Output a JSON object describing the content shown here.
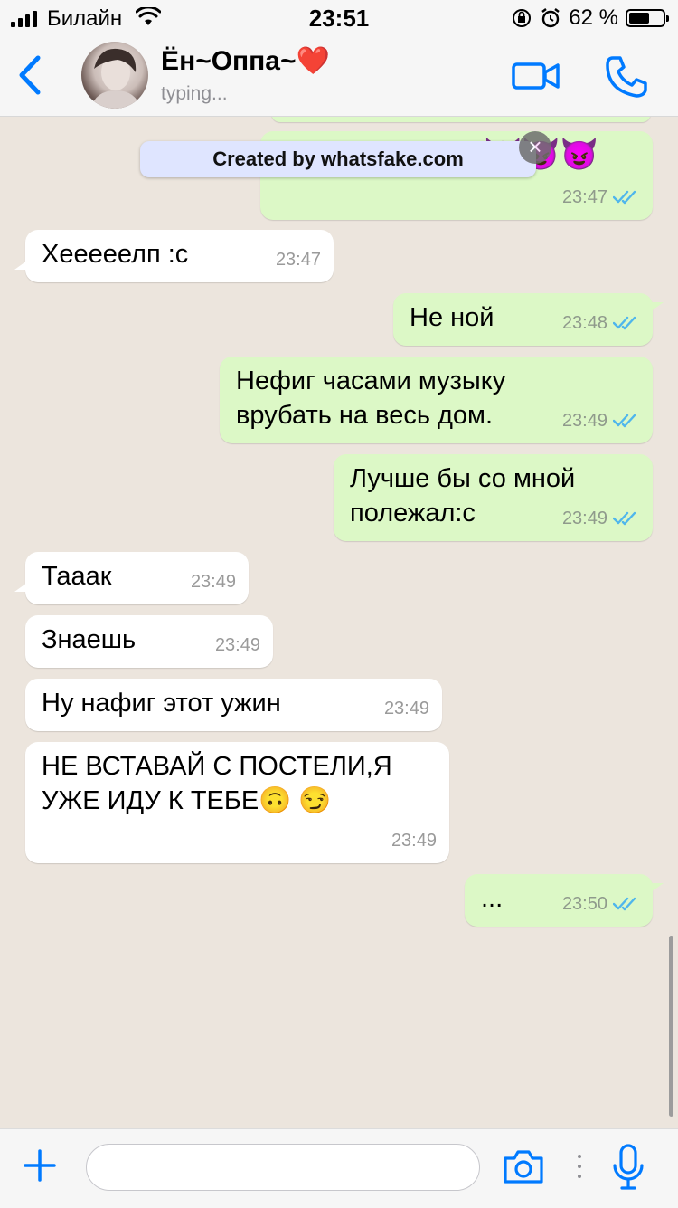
{
  "status_bar": {
    "carrier": "Билайн",
    "time": "23:51",
    "battery_text": "62 %",
    "battery_level": 0.62
  },
  "header": {
    "contact_name": "Ён~Оппа~❤️",
    "contact_status": "typing...",
    "icons": {
      "back": "chevron-left-icon",
      "video": "video-camera-icon",
      "call": "phone-icon"
    }
  },
  "watermark": {
    "text": "Created by whatsfake.com",
    "emojis": "😈😈😈"
  },
  "messages": [
    {
      "direction": "out",
      "text": "",
      "time": "23:47",
      "status": "read"
    },
    {
      "direction": "in",
      "text": "Хееееелп :с",
      "time": "23:47"
    },
    {
      "direction": "out",
      "text": "Не ной",
      "time": "23:48",
      "status": "read"
    },
    {
      "direction": "out",
      "text": "Нефиг часами музыку\nврубать на весь дом.",
      "time": "23:49",
      "status": "read"
    },
    {
      "direction": "out",
      "text": "Лучше бы со мной\nполежал:с",
      "time": "23:49",
      "status": "read"
    },
    {
      "direction": "in",
      "text": "Тааак",
      "time": "23:49"
    },
    {
      "direction": "in",
      "text": "Знаешь",
      "time": "23:49"
    },
    {
      "direction": "in",
      "text": "Ну нафиг этот ужин",
      "time": "23:49"
    },
    {
      "direction": "in",
      "text": "НЕ ВСТАВАЙ С ПОСТЕЛИ,Я\nУЖЕ ИДУ К ТЕБЕ🙃 😏",
      "time": "23:49"
    },
    {
      "direction": "out",
      "text": "...",
      "time": "23:50",
      "status": "read"
    }
  ],
  "input_bar": {
    "placeholder": "",
    "icons": {
      "attach": "plus-icon",
      "camera": "camera-icon",
      "more": "more-dots-icon",
      "mic": "microphone-icon"
    }
  },
  "colors": {
    "accent": "#007aff",
    "outgoing_bubble": "#dcf8c6",
    "incoming_bubble": "#ffffff",
    "chat_background": "#ece5dd",
    "read_ticks": "#4fb6ec"
  }
}
